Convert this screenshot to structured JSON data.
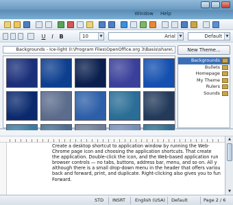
{
  "window": {
    "menus": [
      "Window",
      "Help"
    ]
  },
  "toolbar": {
    "style_value": "Default",
    "font_value": "Arial",
    "size_value": "10",
    "bold_label": "B",
    "italic_label": "I",
    "underline_label": "U"
  },
  "gallery": {
    "new_theme_label": "New Theme...",
    "path_text": "Backgrounds - Ice-light (I:\\Program Files\\OpenOffice.org 3\\Basis\\share\\",
    "themes": [
      {
        "label": "Backgrounds",
        "selected": true
      },
      {
        "label": "Bullets",
        "selected": false
      },
      {
        "label": "Homepage",
        "selected": false
      },
      {
        "label": "My Theme",
        "selected": false
      },
      {
        "label": "Rulers",
        "selected": false
      },
      {
        "label": "Sounds",
        "selected": false
      }
    ],
    "thumb_colors": [
      "#1a2f7a",
      "#0d3f8f",
      "#0a1f4e",
      "#3a3f9a",
      "#1450b0",
      "#0b2a6e",
      "#5c6c8c",
      "#2d5fa8",
      "#2a6d96",
      "#233a5a",
      "#3d7ca0",
      "#4a6f92",
      "#6e7f96",
      "#7590b8",
      "#2f6f8f"
    ]
  },
  "document": {
    "lines": [
      "Create a desktop shortcut to application window by running the Web-",
      "Chrome page icon and choosing the application shortcuts. That create",
      "the application. Double-click the icon, and the Web-based application run",
      "browser controls — no tabs, buttons, address bar, menu, and so on. All y",
      "although there is a small drop-down menu in the header that offers variou",
      "back and forward, print, and duplicate. Right-clicking also gives you to func",
      "Forward."
    ]
  },
  "statusbar": {
    "page": "Page 2 / 6",
    "style": "Default",
    "language": "English (USA)",
    "insert": "INSRT",
    "selection": "STD"
  }
}
